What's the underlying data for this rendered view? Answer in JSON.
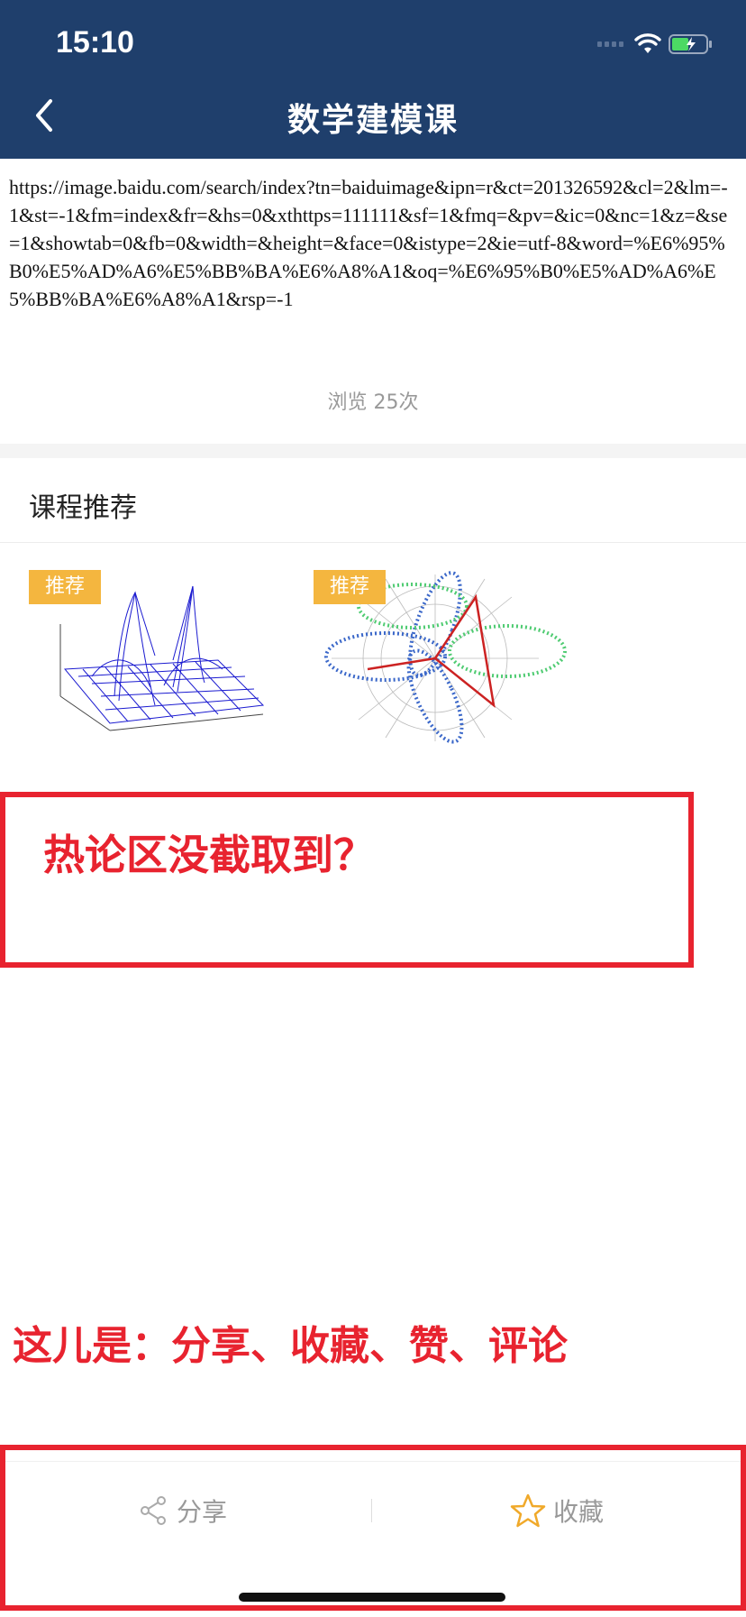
{
  "status_bar": {
    "time": "15:10"
  },
  "nav": {
    "title": "数学建模课"
  },
  "article": {
    "url_text": "https://image.baidu.com/search/index?tn=baiduimage&ipn=r&ct=201326592&cl=2&lm=-1&st=-1&fm=index&fr=&hs=0&xthttps=111111&sf=1&fmq=&pv=&ic=0&nc=1&z=&se=1&showtab=0&fb=0&width=&height=&face=0&istype=2&ie=utf-8&word=%E6%95%B0%E5%AD%A6%E5%BB%BA%E6%A8%A1&oq=%E6%95%B0%E5%AD%A6%E5%BB%BA%E6%A8%A1&rsp=-1",
    "views": "浏览 25次"
  },
  "recommend": {
    "title": "课程推荐",
    "cards": [
      {
        "badge": "推荐"
      },
      {
        "badge": "推荐"
      }
    ]
  },
  "annotations": {
    "note1": "热论区没截取到？",
    "note2": "这儿是：分享、收藏、赞、评论"
  },
  "bottom_bar": {
    "share_label": "分享",
    "favorite_label": "收藏"
  },
  "colors": {
    "nav_bg": "#1f3f6c",
    "badge": "#f4b63f",
    "annotation_red": "#e8232f"
  }
}
